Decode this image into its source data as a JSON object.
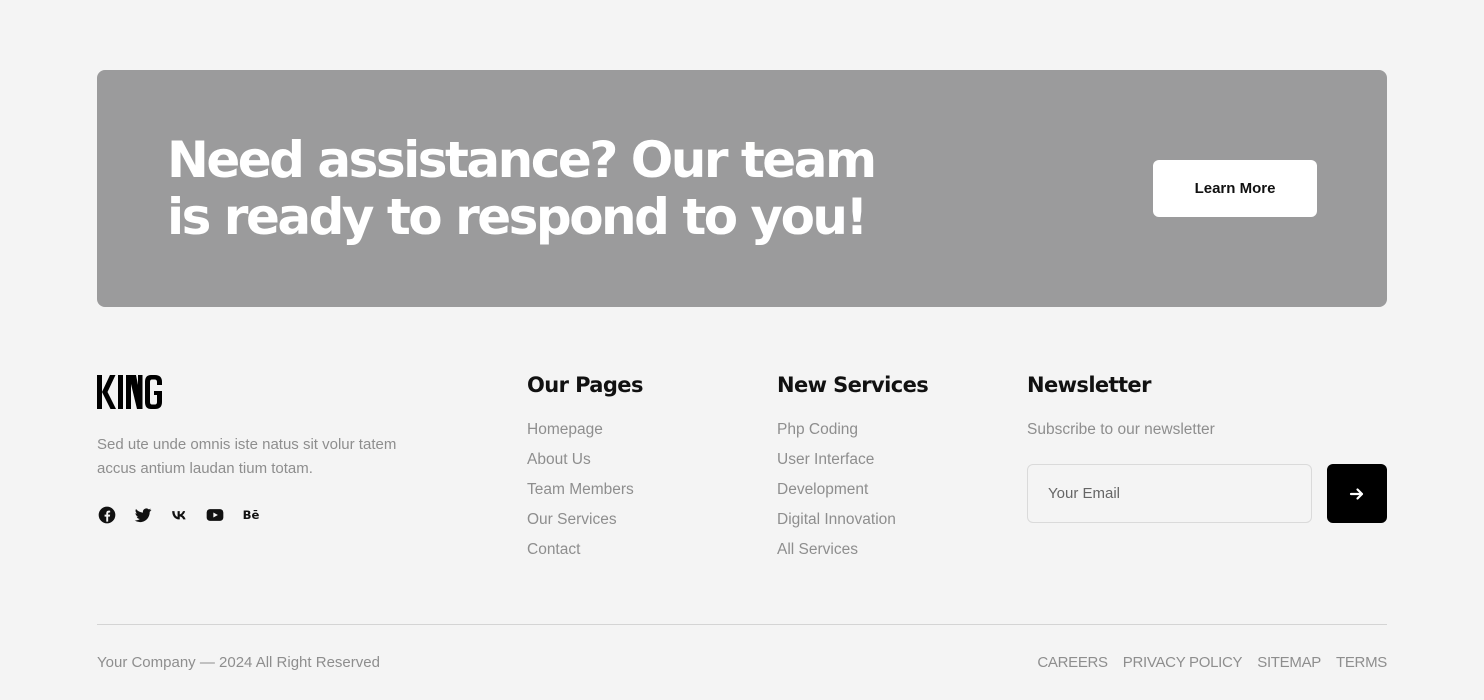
{
  "cta": {
    "title": "Need assistance? Our team is ready to respond to you!",
    "button_label": "Learn More"
  },
  "brand": {
    "logo_text": "KING",
    "description": "Sed ute unde omnis iste natus sit volur tatem accus antium laudan tium totam."
  },
  "social": [
    {
      "icon": "facebook-icon"
    },
    {
      "icon": "twitter-icon"
    },
    {
      "icon": "vk-icon"
    },
    {
      "icon": "youtube-icon"
    },
    {
      "icon": "behance-icon",
      "text": "Bē"
    }
  ],
  "pages": {
    "heading": "Our Pages",
    "items": [
      "Homepage",
      "About Us",
      "Team Members",
      "Our Services",
      "Contact"
    ]
  },
  "services": {
    "heading": "New Services",
    "items": [
      "Php Coding",
      "User Interface",
      "Development",
      "Digital Innovation",
      "All Services"
    ]
  },
  "newsletter": {
    "heading": "Newsletter",
    "subtitle": "Subscribe to our newsletter",
    "email_placeholder": "Your Email",
    "submit_icon": "arrow-right-icon"
  },
  "footer": {
    "copyright": "Your Company — 2024 All Right Reserved",
    "links": [
      "CAREERS",
      "PRIVACY POLICY",
      "SITEMAP",
      "TERMS"
    ]
  },
  "colors": {
    "page_bg": "#f4f4f4",
    "cta_bg": "#9b9b9c",
    "muted_text": "#8e8e8e",
    "dark": "#111111"
  }
}
